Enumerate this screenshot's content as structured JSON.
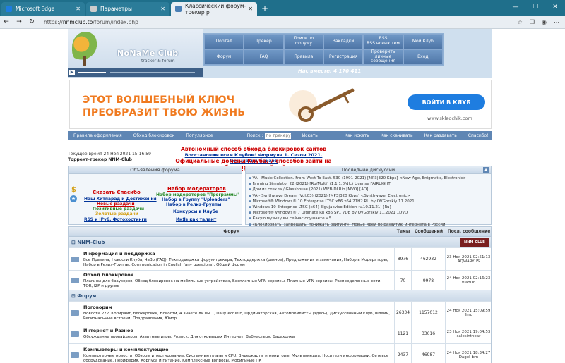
{
  "browser": {
    "tabs": [
      {
        "title": "Microsoft Edge",
        "color": "#1e7de0"
      },
      {
        "title": "Параметры",
        "color": "#cccccc"
      },
      {
        "title": "Классический форум-трекер р",
        "color": "#4a7fb5"
      }
    ],
    "new_tab": "+",
    "url_prefix": "https://",
    "url_host": "nnmclub.to",
    "url_path": "/forum/index.php"
  },
  "header": {
    "logo_title": "NoNaMe Club",
    "logo_sub": "tracker & forum",
    "menu": [
      "Портал",
      "Трекер",
      "Поиск по форуму",
      "Закладки",
      "RSS\nRSS новых тем",
      "Мой Клуб",
      "Форум",
      "FAQ",
      "Правила",
      "Регистрация",
      "Проверить личные сообщения",
      "Вход"
    ],
    "online": "Нас вместе: 4 170 411"
  },
  "banner": {
    "line1": "ЭТОТ ВОЛШЕБНЫЙ КЛЮЧ",
    "line2": "ПРЕОБРАЗИТ ТВОЮ ЖИЗНЬ",
    "button": "ВОЙТИ В КЛУБ",
    "site": "www.skladchik.com"
  },
  "searchbar": {
    "items_left": [
      "Правила оформления",
      "Обход блокировок",
      "Популярное"
    ],
    "label": "Поиск :",
    "placeholder": "по трекеру",
    "go": "Искать",
    "items_right": [
      "Как искать",
      "Как скачивать",
      "Как раздавать",
      "Спасибо!"
    ]
  },
  "info": {
    "time": "Текущее время 24 Ноя 2021 15:16:59",
    "tracker": "Торрент-трекер NNM-Club",
    "ann1": "Автономный способ обхода блокировок сайтов",
    "ann2": "Восстановим всем Клубом! Формула 1. Сезон 2021. Розыгрыш призов",
    "ann3": "Официальные домены Клуба, 7 способов зайти на заблокированный сайт"
  },
  "forum_objects": {
    "title": "Объявления форума",
    "links": [
      {
        "text": "Сказать Спасибо",
        "color": "#c00"
      },
      {
        "text": "Наш Хитпарад и Достижения",
        "color": "#003399"
      },
      {
        "text": "Новые раздачи",
        "color": "#c00"
      },
      {
        "text": "Позитивные раздачи",
        "color": "#2a8a2a"
      },
      {
        "text": "Золотые раздачи",
        "color": "#d4a017"
      },
      {
        "text": "RSS и IPv6, Фотохостинги",
        "color": "#003399"
      },
      {
        "text": "Набор Модераторов",
        "color": "#c00"
      },
      {
        "text": "Набор модераторов \"Программы\"",
        "color": "#2a8a2a"
      },
      {
        "text": "Набор в Группу \"Uploaders\"",
        "color": "#003399"
      },
      {
        "text": "Набор в Релиз-Группы",
        "color": "#003399"
      },
      {
        "text": "Конкурсы в Клубе",
        "color": "#003399"
      },
      {
        "text": "ИнЯз как талант",
        "color": "#003399"
      }
    ]
  },
  "discussions": {
    "title": "Последние дискуссии",
    "items": [
      "VA - Music Collection. From West To East. 530 (1991-2021) [MP3|320 Kbps] <New Age, Enigmatic, Electronic>",
      "Farming Simulator 22 (2021) [Ru/Multi] (1.1.1.0/dlc) License FAIRLIGHT",
      "Дом из стекла / Glasshouse (2021) WEB-DLRip [MVO] [AO]",
      "VA - Synthwave Dream (Vol.03) (2021) [MP3|320 Kbps] <Synthwave, Electronic>",
      "Microsoft® Windows® 10 Enterprise LTSC x86 x64 21H2 RU by OVGorskiy 11.2021",
      "Windows 10 Enterprise LTSC (x64) Elgujakviso Edition (v.10.11.21) [Ru]",
      "Microsoft® Windows® 7 Ultimate Ru x86 SP1 7DB by OVGorskiy 11.2021 1DVD",
      "Какую музыку вы сейчас слушаете v.5",
      "«Блокировать, запрещать, понижать рейтинг». Новые идеи по развитию интернета в России"
    ]
  },
  "forum": {
    "head": [
      "Форум",
      "Темы",
      "Сообщений",
      "Посл. сообщение"
    ],
    "categories": [
      {
        "name": "NNM-Club",
        "badge": "NNM-CLUB",
        "rows": [
          {
            "title": "Информация и поддержка",
            "subs": "Все Правила, Новости Клуба, ЧаВо (FAQ), Техподдержка форум-трекера, Техподдержка (разное), Предложения и замечания, Набор в Модераторы, Набор в Релиз-Группы, Communication in English (any questions), Общий форум",
            "topics": "8976",
            "posts": "462932",
            "last_date": "23 Ноя 2021 02:51:13",
            "last_user": "AQWARYUS"
          },
          {
            "title": "Обход блокировок",
            "subs": "Плагины для браузеров, Обход блокировок на мобильных устройствах, Бесплатные VPN сервисы, Платные VPN сервисы, Распределенные сети. TOR, I2P и другие",
            "topics": "70",
            "posts": "9978",
            "last_date": "24 Ноя 2021 02:16:23",
            "last_user": "VladDn"
          }
        ]
      },
      {
        "name": "Форум",
        "badge": "",
        "rows": [
          {
            "title": "Поговорим",
            "subs": "Новости P2P, Копирайт, блокировки, Новости, А знаете ли вы..., DailyTechInfo, Ординаторская, Автомобилисты (здесь), Дискуссионный клуб, Флейм, Региональные встречи, Поздравления, Юмор",
            "topics": "26334",
            "posts": "1157012",
            "last_date": "24 Ноя 2021 15:09:59",
            "last_user": "fmc"
          },
          {
            "title": "Интернет и Разное",
            "subs": "Обсуждение провайдеров, Азартные игры, Розыск, Для открывших Интернет, Вебмастеру, Барахолка",
            "topics": "1121",
            "posts": "33616",
            "last_date": "23 Ноя 2021 19:04:53",
            "last_user": "salesinthear"
          },
          {
            "title": "Компьютеры и комплектующие",
            "subs": "Компьютерные новости, Обзоры и тестирование, Системные платы и CPU, Видеокарты и мониторы, Мультимедиа, Носители информации, Сетевое оборудование, Периферия, Корпуса и питание, Комплексные вопросы, Мобильные ПК",
            "topics": "2437",
            "posts": "46987",
            "last_date": "24 Ноя 2021 18:34:27",
            "last_user": "Dagel_bm"
          }
        ]
      }
    ]
  }
}
